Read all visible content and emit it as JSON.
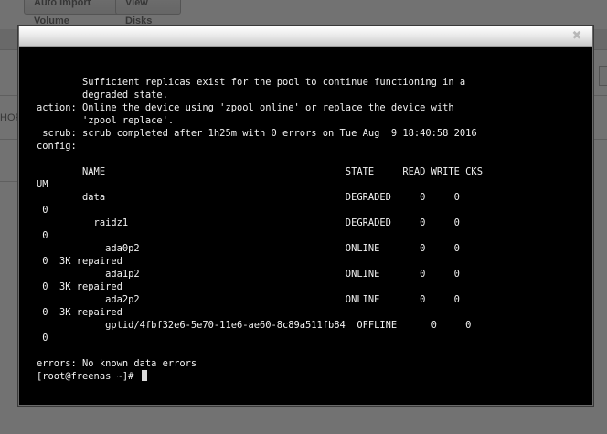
{
  "background": {
    "buttons": [
      "Auto Import Volume",
      "View Disks"
    ],
    "side_text": "HOP"
  },
  "dialog": {
    "close_icon": "close-icon"
  },
  "terminal": {
    "lines": [
      "        Sufficient replicas exist for the pool to continue functioning in a",
      "        degraded state.",
      "action: Online the device using 'zpool online' or replace the device with",
      "        'zpool replace'.",
      " scrub: scrub completed after 1h25m with 0 errors on Tue Aug  9 18:40:58 2016",
      "config:",
      "",
      "        NAME                                          STATE     READ WRITE CKS",
      "UM",
      "        data                                          DEGRADED     0     0",
      " 0",
      "          raidz1                                      DEGRADED     0     0",
      " 0",
      "            ada0p2                                    ONLINE       0     0",
      " 0  3K repaired",
      "            ada1p2                                    ONLINE       0     0",
      " 0  3K repaired",
      "            ada2p2                                    ONLINE       0     0",
      " 0  3K repaired",
      "            gptid/4fbf32e6-5e70-11e6-ae60-8c89a511fb84  OFFLINE      0     0",
      " 0",
      "",
      "errors: No known data errors"
    ],
    "prompt": "[root@freenas ~]# "
  }
}
